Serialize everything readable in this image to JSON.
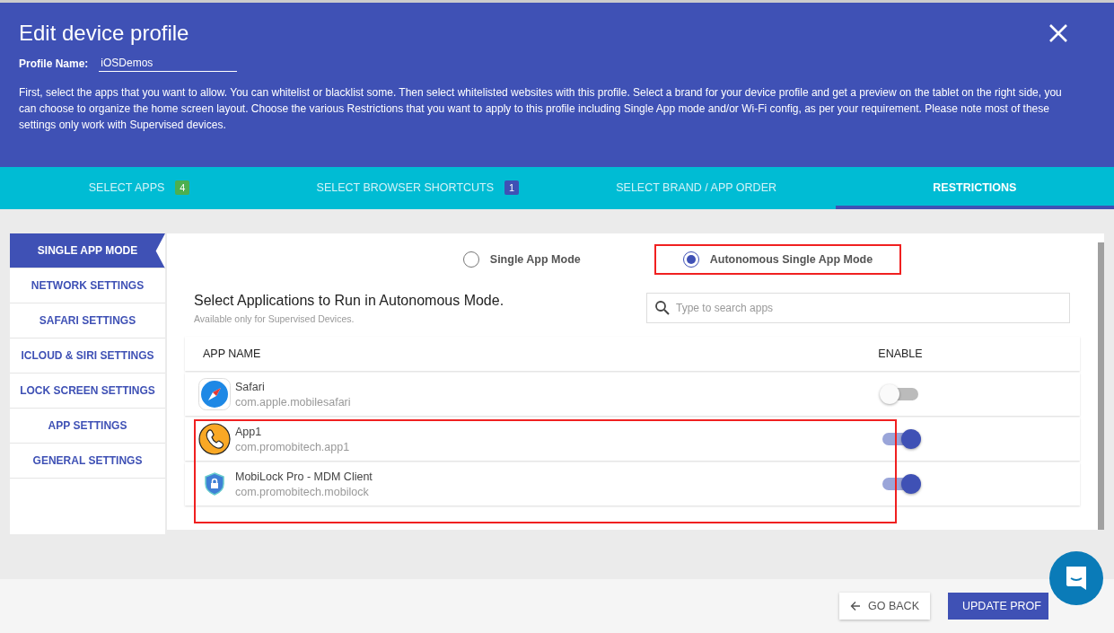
{
  "header": {
    "title": "Edit device profile",
    "profile_label": "Profile Name:",
    "profile_value": "iOSDemos",
    "description": "First, select the apps that you want to allow. You can whitelist or blacklist some. Then select whitelisted websites with this profile. Select a brand for your device profile and get a preview on the tablet on the right side, you can choose to organize the home screen layout. Choose the various Restrictions that you want to apply to this profile including Single App mode and/or Wi-Fi config, as per your requirement. Please note most of these settings only work with Supervised devices."
  },
  "tabs": [
    {
      "label": "SELECT APPS",
      "badge": "4",
      "color": "#4caf50",
      "selected": false
    },
    {
      "label": "SELECT BROWSER SHORTCUTS",
      "badge": "1",
      "color": "#3f51b5",
      "selected": false
    },
    {
      "label": "SELECT BRAND / APP ORDER",
      "selected": false
    },
    {
      "label": "RESTRICTIONS",
      "selected": true
    }
  ],
  "sidebar": {
    "items": [
      {
        "label": "SINGLE APP MODE",
        "selected": true
      },
      {
        "label": "NETWORK SETTINGS",
        "selected": false
      },
      {
        "label": "SAFARI SETTINGS",
        "selected": false
      },
      {
        "label": "ICLOUD & SIRI SETTINGS",
        "selected": false
      },
      {
        "label": "LOCK SCREEN SETTINGS",
        "selected": false
      },
      {
        "label": "APP SETTINGS",
        "selected": false
      },
      {
        "label": "GENERAL SETTINGS",
        "selected": false
      }
    ]
  },
  "modes": [
    {
      "label": "Single App Mode",
      "selected": false,
      "highlighted": false
    },
    {
      "label": "Autonomous Single App Mode",
      "selected": true,
      "highlighted": true
    }
  ],
  "section": {
    "title": "Select Applications to Run in Autonomous Mode.",
    "subtitle": "Available only for Supervised Devices.",
    "search": {
      "placeholder": "Type to search apps"
    }
  },
  "table": {
    "columns": [
      "APP NAME",
      "ENABLE"
    ],
    "rows": [
      {
        "kind": "safari",
        "name": "Safari",
        "bundle": "com.apple.mobilesafari",
        "enabled": false
      },
      {
        "kind": "phone",
        "name": "App1",
        "bundle": "com.promobitech.app1",
        "enabled": true
      },
      {
        "kind": "shield",
        "name": "MobiLock Pro - MDM Client",
        "bundle": "com.promobitech.mobilock",
        "enabled": true
      }
    ]
  },
  "footer": {
    "back": "GO BACK",
    "update": "UPDATE PROF"
  }
}
